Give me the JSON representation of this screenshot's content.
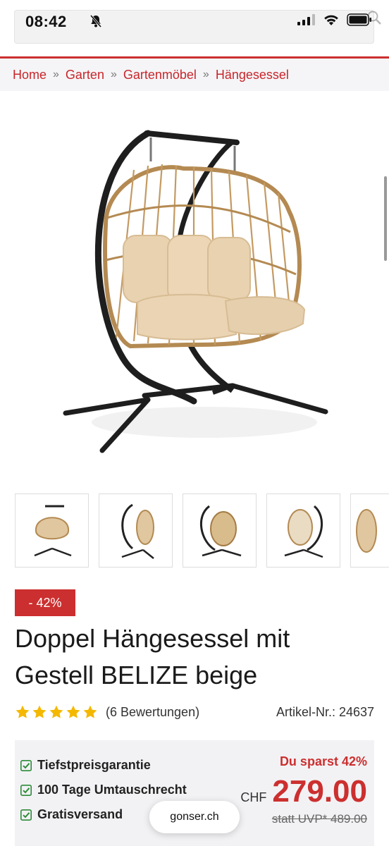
{
  "status": {
    "time": "08:42"
  },
  "breadcrumb": [
    "Home",
    "Garten",
    "Gartenmöbel",
    "Hängesessel"
  ],
  "breadcrumb_separator": "»",
  "product": {
    "discount": "- 42%",
    "title_line1": "Doppel Hängesessel mit",
    "title_line2": "Gestell BELIZE beige",
    "rating": 5,
    "reviews": "(6 Bewertungen)",
    "article": "Artikel-Nr.: 24637"
  },
  "perks": [
    "Tiefstpreisgarantie",
    "100 Tage Umtauschrecht",
    "Gratisversand"
  ],
  "pricing": {
    "savings": "Du sparst 42%",
    "currency": "CHF",
    "price": "279.00",
    "uvp": "statt UVP* 489.00"
  },
  "site": "gonser.ch",
  "colors": {
    "accent": "#cc2f2f",
    "star": "#f5b800",
    "check": "#2e8b3a"
  }
}
